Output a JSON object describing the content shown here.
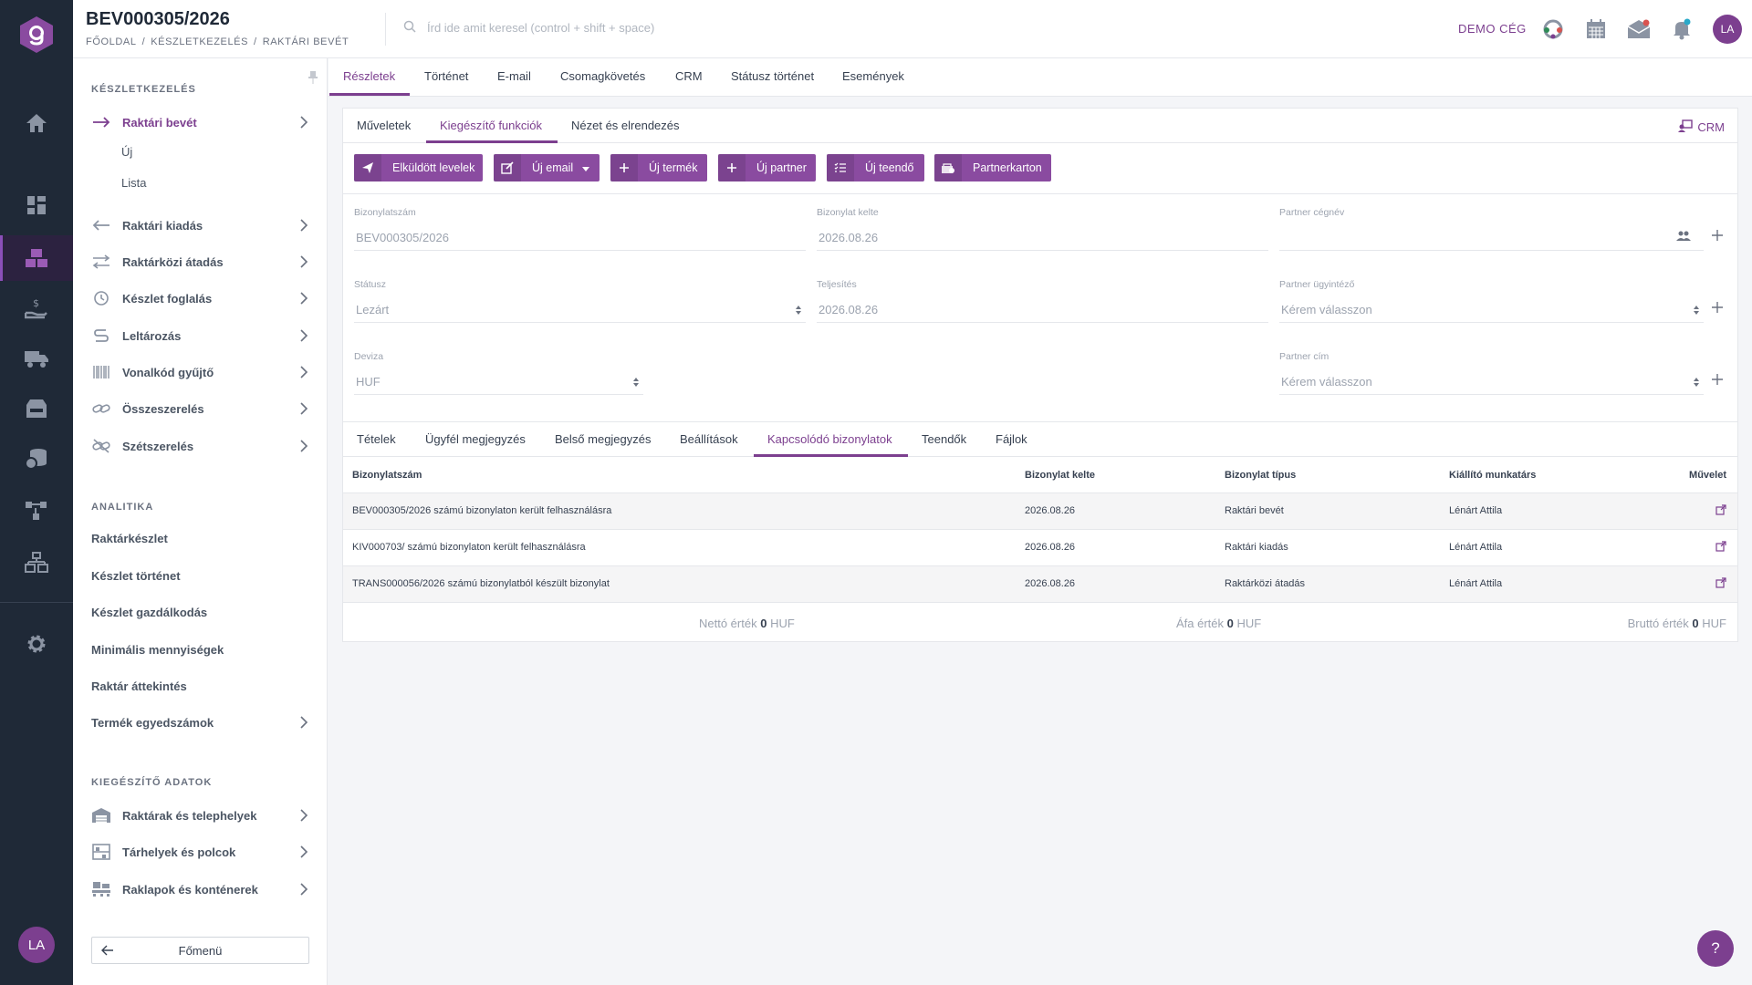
{
  "header": {
    "title": "BEV000305/2026",
    "breadcrumb": [
      "FŐOLDAL",
      "/",
      "KÉSZLETKEZELÉS",
      "/",
      "RAKTÁRI BEVÉT"
    ],
    "search_placeholder": "Írd ide amit keresel (control + shift + space)",
    "company": "DEMO CÉG",
    "user_initials": "LA"
  },
  "rail": {
    "user_initials": "LA",
    "icons": [
      "logo",
      "home-icon",
      "dashboard-icon",
      "inventory-icon",
      "finance-icon",
      "delivery-icon",
      "warehouse-icon",
      "database-icon",
      "workflow-icon",
      "organization-icon",
      "settings-icon"
    ]
  },
  "sidebar": {
    "section_inventory": "KÉSZLETKEZELÉS",
    "items": [
      {
        "label": "Raktári bevét",
        "icon": "arrow-right-icon",
        "active": true
      },
      {
        "label": "Raktári kiadás",
        "icon": "arrow-left-icon"
      },
      {
        "label": "Raktárközi átadás",
        "icon": "transfer-icon"
      },
      {
        "label": "Készlet foglalás",
        "icon": "reservation-icon"
      },
      {
        "label": "Leltározás",
        "icon": "inventory-count-icon"
      },
      {
        "label": "Vonalkód gyűjtő",
        "icon": "barcode-icon"
      },
      {
        "label": "Összeszerelés",
        "icon": "link-icon"
      },
      {
        "label": "Szétszerelés",
        "icon": "unlink-icon"
      }
    ],
    "sub_items": [
      "Új",
      "Lista"
    ],
    "section_analytics": "ANALITIKA",
    "analytics": [
      "Raktárkészlet",
      "Készlet történet",
      "Készlet gazdálkodás",
      "Minimális mennyiségek",
      "Raktár áttekintés",
      "Termék egyedszámok"
    ],
    "section_extra": "KIEGÉSZÍTŐ ADATOK",
    "extra": [
      {
        "label": "Raktárak és telephelyek",
        "icon": "building-icon"
      },
      {
        "label": "Tárhelyek és polcok",
        "icon": "shelf-icon"
      },
      {
        "label": "Raklapok és konténerek",
        "icon": "pallet-icon"
      }
    ],
    "back_label": "Főmenü"
  },
  "main_tabs": [
    "Részletek",
    "Történet",
    "E-mail",
    "Csomagkövetés",
    "CRM",
    "Státusz történet",
    "Események"
  ],
  "sub_tabs": [
    "Műveletek",
    "Kiegészítő funkciók",
    "Nézet és elrendezés"
  ],
  "crm_link": "CRM",
  "toolbar": [
    {
      "label": "Elküldött levelek",
      "icon": "send-icon"
    },
    {
      "label": "Új email",
      "icon": "compose-icon"
    },
    {
      "label": "Új termék",
      "icon": "plus-icon"
    },
    {
      "label": "Új partner",
      "icon": "plus-icon"
    },
    {
      "label": "Új teendő",
      "icon": "checklist-icon"
    },
    {
      "label": "Partnerkarton",
      "icon": "card-icon"
    }
  ],
  "form": {
    "doc_number": {
      "label": "Bizonylatszám",
      "value": "BEV000305/2026"
    },
    "doc_date": {
      "label": "Bizonylat kelte",
      "value": "2026.08.26"
    },
    "partner_name": {
      "label": "Partner cégnév",
      "value": ""
    },
    "status": {
      "label": "Státusz",
      "value": "Lezárt"
    },
    "fulfillment": {
      "label": "Teljesítés",
      "value": "2026.08.26"
    },
    "partner_agent": {
      "label": "Partner ügyintéző",
      "value": "Kérem válasszon"
    },
    "currency": {
      "label": "Deviza",
      "value": "HUF"
    },
    "partner_address": {
      "label": "Partner cím",
      "value": "Kérem válasszon"
    }
  },
  "bottom_tabs": [
    "Tételek",
    "Ügyfél megjegyzés",
    "Belső megjegyzés",
    "Beállítások",
    "Kapcsolódó bizonylatok",
    "Teendők",
    "Fájlok"
  ],
  "table": {
    "columns": [
      "Bizonylatszám",
      "Bizonylat kelte",
      "Bizonylat típus",
      "Kiállító munkatárs",
      "Művelet"
    ],
    "rows": [
      [
        "BEV000305/2026 számú bizonylaton került felhasználásra",
        "2026.08.26",
        "Raktári bevét",
        "Lénárt Attila"
      ],
      [
        "KIV000703/ számú bizonylaton került felhasználásra",
        "2026.08.26",
        "Raktári kiadás",
        "Lénárt Attila"
      ],
      [
        "TRANS000056/2026 számú bizonylatból készült bizonylat",
        "2026.08.26",
        "Raktárközi átadás",
        "Lénárt Attila"
      ]
    ]
  },
  "totals": {
    "net_label": "Nettó érték",
    "net_value": "0",
    "net_cur": "HUF",
    "vat_label": "Áfa érték",
    "vat_value": "0",
    "vat_cur": "HUF",
    "gross_label": "Bruttó érték",
    "gross_value": "0",
    "gross_cur": "HUF"
  },
  "help_label": "?",
  "colors": {
    "accent": "#7c3f8f",
    "rail": "#1f2937",
    "button": "#8a4ba0"
  }
}
